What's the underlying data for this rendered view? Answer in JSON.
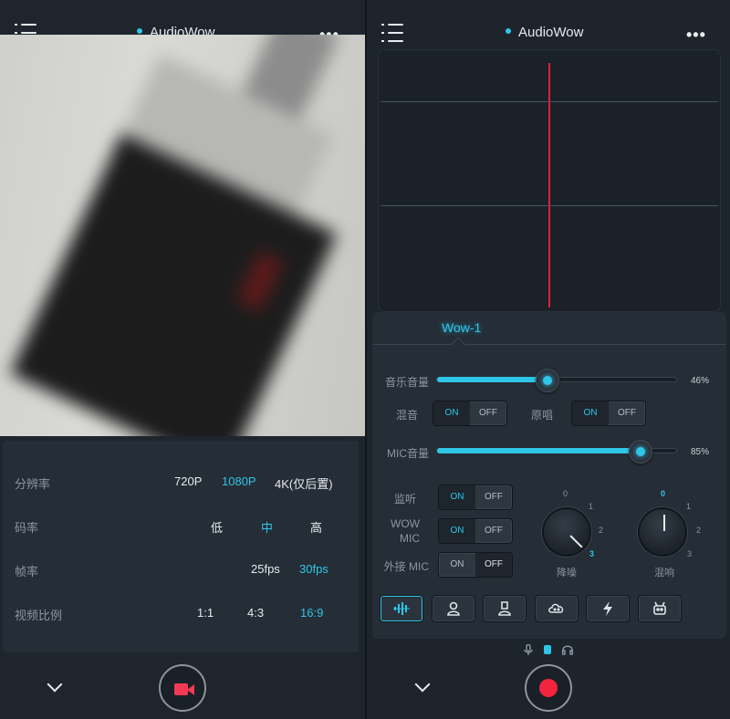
{
  "left": {
    "app_title": "AudioWow",
    "more_glyph": "•••",
    "settings": [
      {
        "label": "分辨率",
        "options": [
          "720P",
          "1080P",
          "4K(仅后置)"
        ],
        "selected": 1
      },
      {
        "label": "码率",
        "options": [
          "低",
          "中",
          "高"
        ],
        "selected": 1
      },
      {
        "label": "帧率",
        "options": [
          "25fps",
          "30fps"
        ],
        "selected": 1
      },
      {
        "label": "视频比例",
        "options": [
          "1:1",
          "4:3",
          "16:9"
        ],
        "selected": 2
      }
    ]
  },
  "right": {
    "app_title": "AudioWow",
    "more_glyph": "•••",
    "tab": "Wow-1",
    "music_volume": {
      "label": "音乐音量",
      "value": 0.46,
      "pct": "46%"
    },
    "mix": {
      "label": "混音",
      "on": "ON",
      "off": "OFF",
      "state": "on"
    },
    "original": {
      "label": "原唱",
      "on": "ON",
      "off": "OFF",
      "state": "on"
    },
    "mic_volume": {
      "label": "MIC音量",
      "value": 0.85,
      "pct": "85%"
    },
    "monitor": {
      "label": "监听",
      "on": "ON",
      "off": "OFF",
      "state": "on"
    },
    "wow_mic": {
      "label_line1": "WOW",
      "label_line2": "MIC",
      "on": "ON",
      "off": "OFF",
      "state": "on"
    },
    "ext_mic": {
      "label": "外接 MIC",
      "on": "ON",
      "off": "OFF",
      "state": "off"
    },
    "noise_knob": {
      "label": "降噪",
      "ticks": [
        "0",
        "1",
        "2",
        "3"
      ],
      "selected": 3
    },
    "reverb_knob": {
      "label": "混响",
      "ticks": [
        "0",
        "1",
        "2",
        "3"
      ],
      "selected": 0
    },
    "presets": [
      "waveform-icon",
      "person-icon",
      "person-alt-icon",
      "cloud-face-icon",
      "lightning-icon",
      "robot-icon"
    ],
    "selected_preset": 0
  },
  "colors": {
    "accent": "#2fc6e8",
    "record": "#f2243e",
    "spectrum_line": "#e01e3a"
  }
}
